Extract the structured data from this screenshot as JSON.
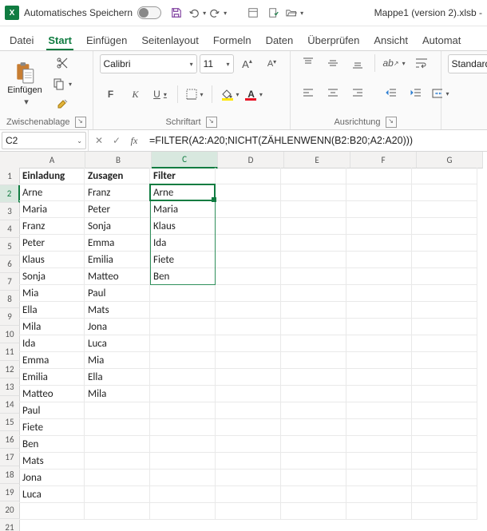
{
  "title": {
    "autosave_label": "Automatisches Speichern",
    "filename": "Mappe1 (version 2).xlsb -"
  },
  "tabs": {
    "file": "Datei",
    "home": "Start",
    "insert": "Einfügen",
    "layout": "Seitenlayout",
    "formulas": "Formeln",
    "data": "Daten",
    "review": "Überprüfen",
    "view": "Ansicht",
    "automate": "Automat"
  },
  "ribbon": {
    "clipboard": {
      "paste": "Einfügen",
      "label": "Zwischenablage"
    },
    "font": {
      "name": "Calibri",
      "size": "11",
      "label": "Schriftart",
      "bold": "F",
      "italic": "K",
      "underline": "U"
    },
    "alignment": {
      "label": "Ausrichtung"
    },
    "number": {
      "format": "Standard"
    }
  },
  "formula_bar": {
    "cell_ref": "C2",
    "formula": "=FILTER(A2:A20;NICHT(ZÄHLENWENN(B2:B20;A2:A20)))"
  },
  "columns": [
    "A",
    "B",
    "C",
    "D",
    "E",
    "F",
    "G"
  ],
  "row_count": 21,
  "headers": {
    "a": "Einladung",
    "b": "Zusagen",
    "c": "Filter"
  },
  "einladung": [
    "Arne",
    "Maria",
    "Franz",
    "Peter",
    "Klaus",
    "Sonja",
    "Mia",
    "Ella",
    "Mila",
    "Ida",
    "Emma",
    "Emilia",
    "Matteo",
    "Paul",
    "Fiete",
    "Ben",
    "Mats",
    "Jona",
    "Luca"
  ],
  "zusagen": [
    "Franz",
    "Peter",
    "Sonja",
    "Emma",
    "Emilia",
    "Matteo",
    "Paul",
    "Mats",
    "Jona",
    "Luca",
    "Mia",
    "Ella",
    "Mila"
  ],
  "filter": [
    "Arne",
    "Maria",
    "Klaus",
    "Ida",
    "Fiete",
    "Ben"
  ],
  "selection": {
    "active_col_index": 2,
    "active_row": 2,
    "spill_rows": 6
  }
}
